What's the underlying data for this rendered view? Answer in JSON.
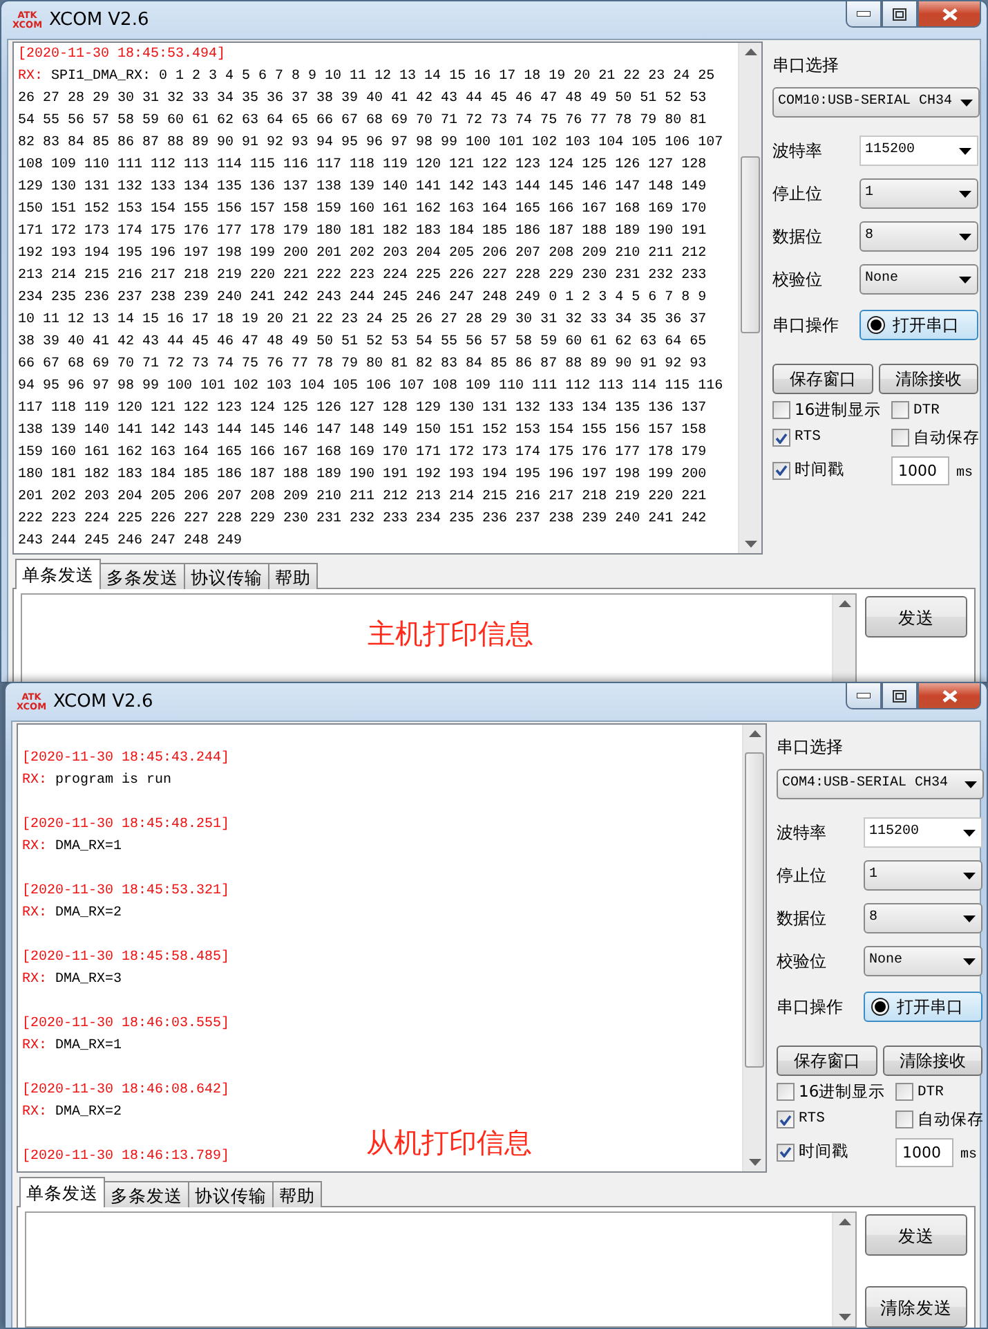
{
  "windows": [
    {
      "logo": [
        "ATK",
        "XCOM"
      ],
      "title": "XCOM V2.6",
      "receive": {
        "blocks": [
          {
            "timestamp": "[2020-11-30 18:45:53.494]",
            "rx_label": "RX:",
            "lines": [
              "SPI1_DMA_RX: 0 1 2 3 4 5 6 7 8 9 10 11 12 13 14 15 16 17 18 19 20 21 22 23 24 25",
              "26 27 28 29 30 31 32 33 34 35 36 37 38 39 40 41 42 43 44 45 46 47 48 49 50 51 52 53",
              "54 55 56 57 58 59 60 61 62 63 64 65 66 67 68 69 70 71 72 73 74 75 76 77 78 79 80 81",
              "82 83 84 85 86 87 88 89 90 91 92 93 94 95 96 97 98 99 100 101 102 103 104 105 106 107",
              "108 109 110 111 112 113 114 115 116 117 118 119 120 121 122 123 124 125 126 127 128",
              "129 130 131 132 133 134 135 136 137 138 139 140 141 142 143 144 145 146 147 148 149",
              "150 151 152 153 154 155 156 157 158 159 160 161 162 163 164 165 166 167 168 169 170",
              "171 172 173 174 175 176 177 178 179 180 181 182 183 184 185 186 187 188 189 190 191",
              "192 193 194 195 196 197 198 199 200 201 202 203 204 205 206 207 208 209 210 211 212",
              "213 214 215 216 217 218 219 220 221 222 223 224 225 226 227 228 229 230 231 232 233",
              "234 235 236 237 238 239 240 241 242 243 244 245 246 247 248 249 0 1 2 3 4 5 6 7 8 9",
              "10 11 12 13 14 15 16 17 18 19 20 21 22 23 24 25 26 27 28 29 30 31 32 33 34 35 36 37",
              "38 39 40 41 42 43 44 45 46 47 48 49 50 51 52 53 54 55 56 57 58 59 60 61 62 63 64 65",
              "66 67 68 69 70 71 72 73 74 75 76 77 78 79 80 81 82 83 84 85 86 87 88 89 90 91 92 93",
              "94 95 96 97 98 99 100 101 102 103 104 105 106 107 108 109 110 111 112 113 114 115 116",
              "117 118 119 120 121 122 123 124 125 126 127 128 129 130 131 132 133 134 135 136 137",
              "138 139 140 141 142 143 144 145 146 147 148 149 150 151 152 153 154 155 156 157 158",
              "159 160 161 162 163 164 165 166 167 168 169 170 171 172 173 174 175 176 177 178 179",
              "180 181 182 183 184 185 186 187 188 189 190 191 192 193 194 195 196 197 198 199 200",
              "201 202 203 204 205 206 207 208 209 210 211 212 213 214 215 216 217 218 219 220 221",
              "222 223 224 225 226 227 228 229 230 231 232 233 234 235 236 237 238 239 240 241 242",
              "243 244 245 246 247 248 249"
            ]
          }
        ]
      },
      "panel": {
        "port_label": "串口选择",
        "port": "COM10:USB-SERIAL CH34",
        "settings": [
          {
            "label": "波特率",
            "value": "115200",
            "kind": "combo"
          },
          {
            "label": "停止位",
            "value": "1",
            "kind": "list"
          },
          {
            "label": "数据位",
            "value": "8",
            "kind": "list"
          },
          {
            "label": "校验位",
            "value": "None",
            "kind": "list"
          }
        ],
        "operation": {
          "label": "串口操作",
          "button": "打开串口"
        },
        "buttons": [
          "保存窗口",
          "清除接收"
        ],
        "options": [
          {
            "label": "16进制显示",
            "checked": false
          },
          {
            "label": "DTR",
            "checked": false
          },
          {
            "label": "RTS",
            "checked": true
          },
          {
            "label": "自动保存",
            "checked": false
          },
          {
            "label": "时间戳",
            "checked": true
          }
        ],
        "interval": {
          "value": "1000",
          "unit": "ms"
        }
      },
      "tabs": [
        {
          "label": "单条发送",
          "selected": true
        },
        {
          "label": "多条发送",
          "selected": false
        },
        {
          "label": "协议传输",
          "selected": false
        },
        {
          "label": "帮助",
          "selected": false
        }
      ],
      "send_buttons": [
        "发送"
      ],
      "send_annotation": "主机打印信息"
    },
    {
      "logo": [
        "ATK",
        "XCOM"
      ],
      "title": "XCOM V2.6",
      "receive": {
        "blocks": [
          {
            "timestamp": "[2020-11-30 18:45:43.244]",
            "rx_label": "RX:",
            "lines": [
              "program is run"
            ]
          },
          {
            "timestamp": "[2020-11-30 18:45:48.251]",
            "rx_label": "RX:",
            "lines": [
              "DMA_RX=1"
            ]
          },
          {
            "timestamp": "[2020-11-30 18:45:53.321]",
            "rx_label": "RX:",
            "lines": [
              "DMA_RX=2"
            ]
          },
          {
            "timestamp": "[2020-11-30 18:45:58.485]",
            "rx_label": "RX:",
            "lines": [
              "DMA_RX=3"
            ]
          },
          {
            "timestamp": "[2020-11-30 18:46:03.555]",
            "rx_label": "RX:",
            "lines": [
              "DMA_RX=1"
            ]
          },
          {
            "timestamp": "[2020-11-30 18:46:08.642]",
            "rx_label": "RX:",
            "lines": [
              "DMA_RX=2"
            ]
          },
          {
            "timestamp": "[2020-11-30 18:46:13.789]"
          }
        ]
      },
      "panel": {
        "port_label": "串口选择",
        "port": "COM4:USB-SERIAL CH34",
        "settings": [
          {
            "label": "波特率",
            "value": "115200",
            "kind": "combo"
          },
          {
            "label": "停止位",
            "value": "1",
            "kind": "list"
          },
          {
            "label": "数据位",
            "value": "8",
            "kind": "list"
          },
          {
            "label": "校验位",
            "value": "None",
            "kind": "list"
          }
        ],
        "operation": {
          "label": "串口操作",
          "button": "打开串口"
        },
        "buttons": [
          "保存窗口",
          "清除接收"
        ],
        "options": [
          {
            "label": "16进制显示",
            "checked": false
          },
          {
            "label": "DTR",
            "checked": false
          },
          {
            "label": "RTS",
            "checked": true
          },
          {
            "label": "自动保存",
            "checked": false
          },
          {
            "label": "时间戳",
            "checked": true
          }
        ],
        "interval": {
          "value": "1000",
          "unit": "ms"
        }
      },
      "tabs": [
        {
          "label": "单条发送",
          "selected": true
        },
        {
          "label": "多条发送",
          "selected": false
        },
        {
          "label": "协议传输",
          "selected": false
        },
        {
          "label": "帮助",
          "selected": false
        }
      ],
      "send_buttons": [
        "发送",
        "清除发送"
      ],
      "receive_annotation": "从机打印信息"
    }
  ]
}
